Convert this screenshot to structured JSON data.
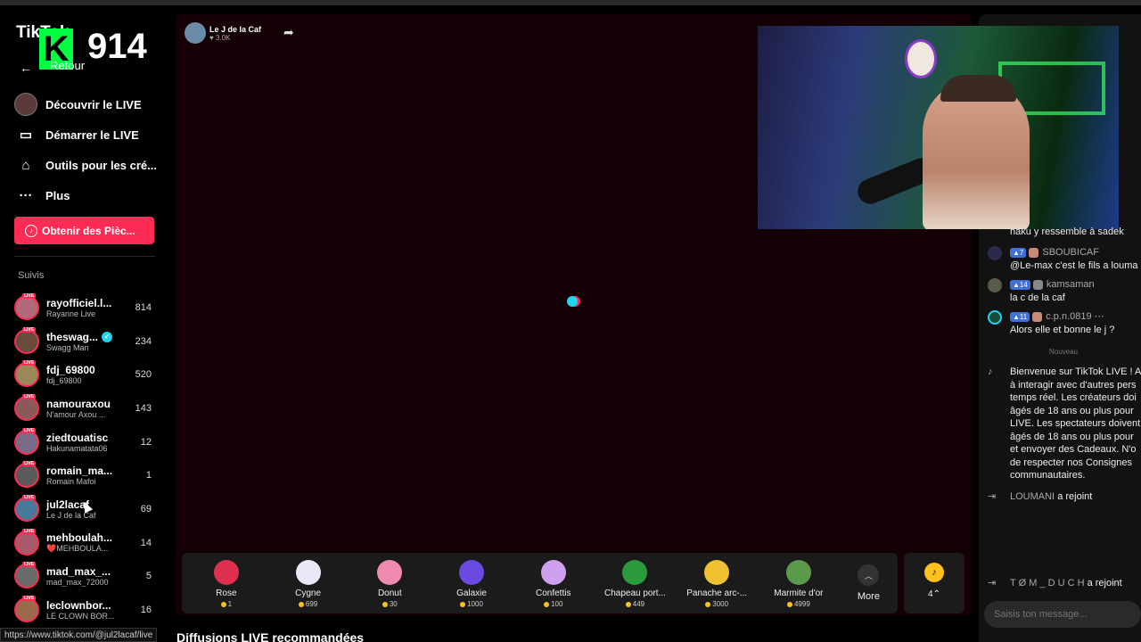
{
  "brand": {
    "app": "TikTok",
    "overlay_letter": "K",
    "overlay_number": "914",
    "back_label": "Retour"
  },
  "nav": [
    {
      "label": "Découvrir le LIVE",
      "icon": "live-avatar-icon"
    },
    {
      "label": "Démarrer le LIVE",
      "icon": "video-camera-icon"
    },
    {
      "label": "Outils pour les cré...",
      "icon": "home-tools-icon"
    },
    {
      "label": "Plus",
      "icon": "more-dots-icon"
    }
  ],
  "coins_button": "Obtenir des Pièc...",
  "following": {
    "title": "Suivis",
    "items": [
      {
        "name": "rayofficiel.l...",
        "sub": "Rayanne Live",
        "count": "814",
        "color": "#b06a7a"
      },
      {
        "name": "theswag...",
        "sub": "Swagg Man",
        "count": "234",
        "color": "#6a4a3a",
        "verified": true
      },
      {
        "name": "fdj_69800",
        "sub": "fdj_69800",
        "count": "520",
        "color": "#9a8a5a"
      },
      {
        "name": "namouraxou",
        "sub": "N'amour Axou ...",
        "count": "143",
        "color": "#8a5a5a"
      },
      {
        "name": "ziedtouatisc",
        "sub": "Hakunamatata06",
        "count": "12",
        "color": "#7a6a8a"
      },
      {
        "name": "romain_ma...",
        "sub": "Romain Mafoi",
        "count": "1",
        "color": "#5a5a5a"
      },
      {
        "name": "jul2lacaf",
        "sub": "Le J de la Caf",
        "count": "69",
        "color": "#4a7a9a"
      },
      {
        "name": "mehboulah...",
        "sub": "❤️MEHBOULA...",
        "count": "14",
        "color": "#a85a6a"
      },
      {
        "name": "mad_max_...",
        "sub": "mad_max_72000",
        "count": "5",
        "color": "#6a6a6a"
      },
      {
        "name": "leclownbor...",
        "sub": "LE CLOWN BOR...",
        "count": "16",
        "color": "#9a6a4a"
      }
    ]
  },
  "status_url": "https://www.tiktok.com/@jul2lacaf/live",
  "stream": {
    "host_name": "Le J de la Caf",
    "likes": "3.0K"
  },
  "gifts": [
    {
      "name": "Rose",
      "price": "1",
      "color": "#e03050"
    },
    {
      "name": "Cygne",
      "price": "699",
      "color": "#e8e8f8"
    },
    {
      "name": "Donut",
      "price": "30",
      "color": "#f08ab0"
    },
    {
      "name": "Galaxie",
      "price": "1000",
      "color": "#6a4ae0"
    },
    {
      "name": "Confettis",
      "price": "100",
      "color": "#d0a0f0"
    },
    {
      "name": "Chapeau port...",
      "price": "449",
      "color": "#2a9a3a"
    },
    {
      "name": "Panache arc-...",
      "price": "3000",
      "color": "#f0c030"
    },
    {
      "name": "Marmite d'or",
      "price": "4999",
      "color": "#5a9a4a"
    }
  ],
  "more_label": "More",
  "balance": "4⌃",
  "recommended_title": "Diffusions LIVE recommandées",
  "chat": {
    "messages": [
      {
        "text": "haku y ressemble à sadek"
      },
      {
        "level": "7",
        "user": "SBOUBICAF",
        "text": "@Le-max c'est le fils a louma"
      },
      {
        "level": "14",
        "user": "kamsaman",
        "text": "la c de la caf"
      },
      {
        "level": "11",
        "user": "c.p.n.0819 ⋯",
        "text": "Alors elle et bonne le j ?"
      }
    ],
    "new_label": "Nouveau",
    "welcome": "Bienvenue sur TikTok LIVE ! A à interagir avec d'autres pers temps réel. Les créateurs doi âgés de 18 ans ou plus pour LIVE. Les spectateurs doivent âgés de 18 ans ou plus pour et envoyer des Cadeaux. N'o de respecter nos Consignes communautaires.",
    "joins": [
      {
        "user": "LOUMANI",
        "action": "a rejoint"
      },
      {
        "user": "T Ø M _ D U C H",
        "action": "a rejoint"
      }
    ],
    "input_placeholder": "Saisis ton message..."
  },
  "colors": {
    "accent": "#fe2c55",
    "teal": "#20d5ec",
    "coin": "#ffc21a",
    "stage_bg": "#140004"
  }
}
